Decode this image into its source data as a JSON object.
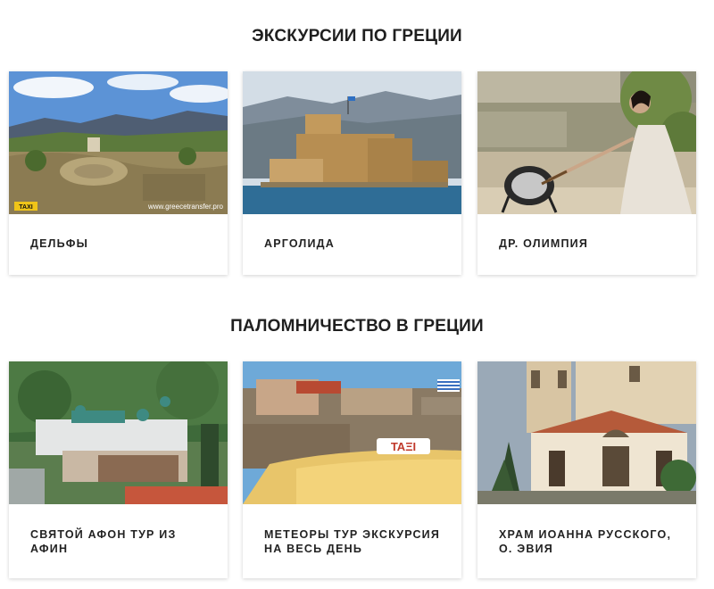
{
  "sections": [
    {
      "title": "ЭКСКУРСИИ ПО ГРЕЦИИ",
      "cards": [
        {
          "label": "ДЕЛЬФЫ",
          "image": "delphi-ruins-photo",
          "image_text": [
            "TAXI",
            "www.greecetransfer.pro"
          ]
        },
        {
          "label": "АРГОЛИДА",
          "image": "bourtzi-fortress-photo"
        },
        {
          "label": "ДР. ОЛИМПИЯ",
          "image": "olympic-flame-ceremony-photo"
        }
      ]
    },
    {
      "title": "ПАЛОМНИЧЕСТВО В ГРЕЦИИ",
      "cards": [
        {
          "label": "СВЯТОЙ АФОН ТУР ИЗ АФИН",
          "image": "mount-athos-monastery-photo"
        },
        {
          "label": "МЕТЕОРЫ ТУР ЭКСКУРСИЯ\nНА ВЕСЬ ДЕНЬ",
          "image": "meteora-taxi-photo",
          "image_text": [
            "TAΞI"
          ]
        },
        {
          "label": "ХРАМ ИОАННА РУССКОГО,\nО. ЭВИЯ",
          "image": "church-st-john-russian-photo"
        }
      ]
    }
  ]
}
